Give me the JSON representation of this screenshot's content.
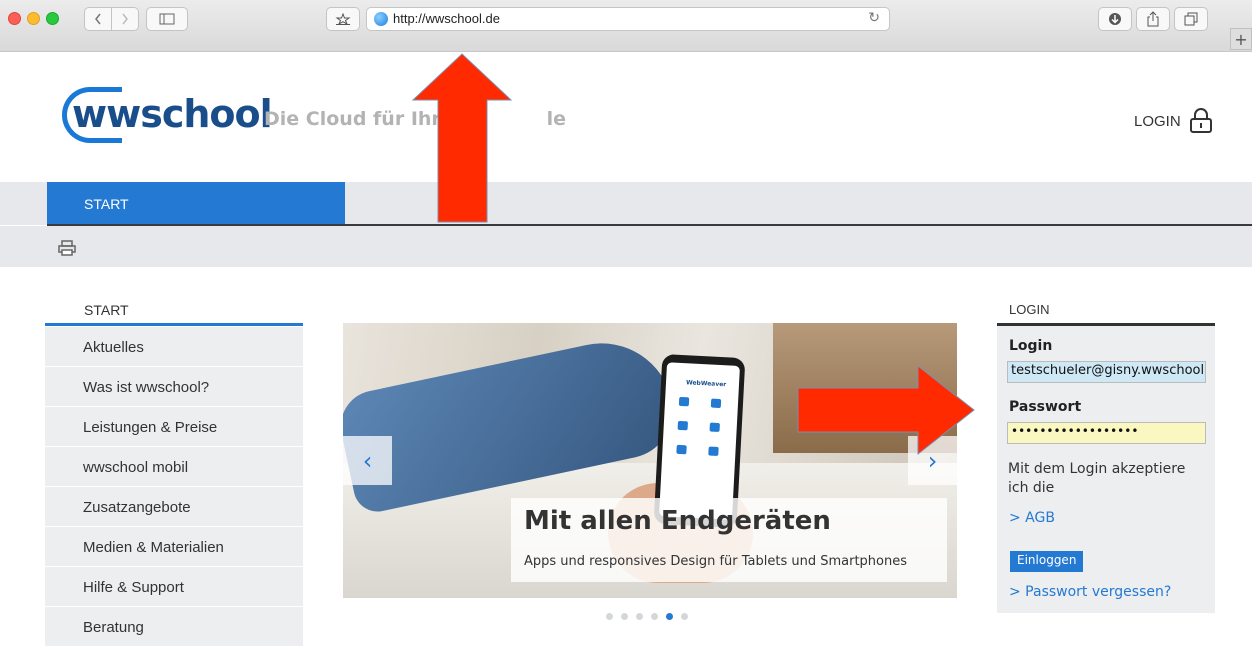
{
  "browser": {
    "url": "http://wwschool.de",
    "bookmark_icon": "star-icon",
    "reload_icon": "reload-icon"
  },
  "header": {
    "logo_text": "wwschool",
    "tagline": "Die Cloud für Ihre",
    "tagline_end": "le",
    "login_label": "LOGIN"
  },
  "nav": {
    "tab_label": "START"
  },
  "sidebar": {
    "title": "START",
    "items": [
      {
        "label": "Aktuelles"
      },
      {
        "label": "Was ist wwschool?"
      },
      {
        "label": "Leistungen & Preise"
      },
      {
        "label": "wwschool mobil"
      },
      {
        "label": "Zusatzangebote"
      },
      {
        "label": "Medien & Materialien"
      },
      {
        "label": "Hilfe & Support"
      },
      {
        "label": "Beratung"
      }
    ]
  },
  "slider": {
    "app_name": "WebWeaver",
    "caption_title": "Mit allen Endgeräten",
    "caption_subtitle": "Apps und responsives Design für Tablets und Smartphones",
    "prev_label": "‹",
    "next_label": "›",
    "dot_count": 6,
    "active_dot": 5
  },
  "login": {
    "title": "LOGIN",
    "login_label": "Login",
    "login_value": "testschueler@gisny.wwschool.de",
    "password_label": "Passwort",
    "password_value": "••••••••••••••••••",
    "accept_text": "Mit dem Login akzeptiere ich die",
    "agb_link": "> AGB",
    "submit_label": "Einloggen",
    "forgot_link": "> Passwort vergessen?"
  },
  "annotation_color": "#ff2a00"
}
